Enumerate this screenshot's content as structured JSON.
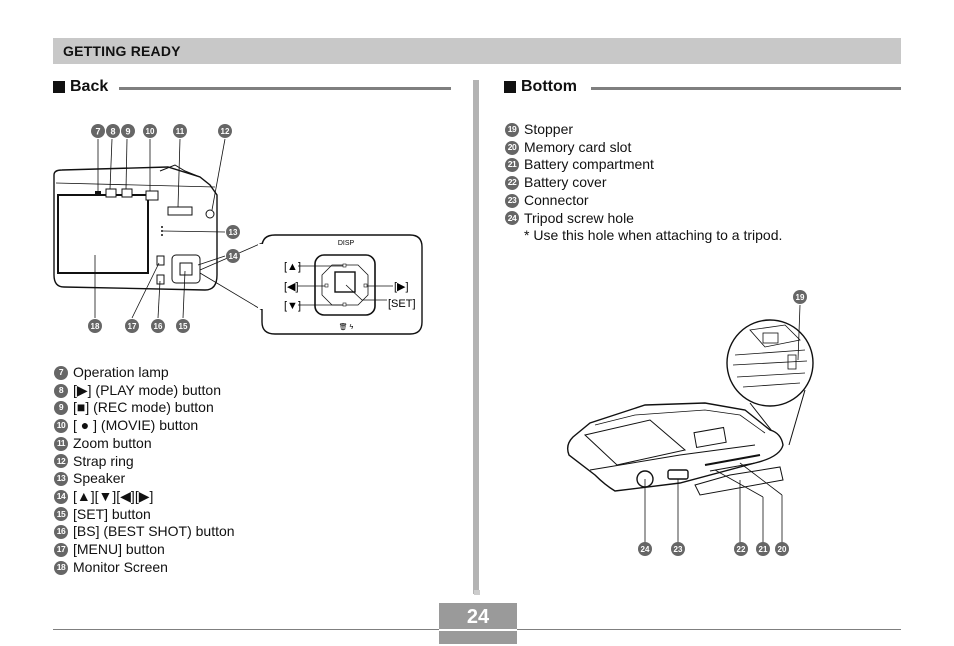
{
  "header": {
    "title": "GETTING READY"
  },
  "back": {
    "title": "Back",
    "callouts": [
      "7",
      "8",
      "9",
      "10",
      "11",
      "12",
      "13",
      "14",
      "15",
      "16",
      "17",
      "18"
    ],
    "dpad": {
      "top_label": "DISP",
      "up": "[▲]",
      "left": "[◀]",
      "down": "[▼]",
      "right": "[▶]",
      "set": "[SET]",
      "bottom_label": "🗑 ϟ"
    },
    "items": [
      {
        "num": "7",
        "text": "Operation lamp"
      },
      {
        "num": "8",
        "text": "[▶] (PLAY mode) button",
        "icon": "play-icon"
      },
      {
        "num": "9",
        "text": "[■] (REC mode) button",
        "icon": "camera-icon"
      },
      {
        "num": "10",
        "text": "[ ● ] (MOVIE) button",
        "icon": "movie-dot-icon"
      },
      {
        "num": "11",
        "text": "Zoom button"
      },
      {
        "num": "12",
        "text": "Strap ring"
      },
      {
        "num": "13",
        "text": "Speaker"
      },
      {
        "num": "14",
        "text": "[▲][▼][◀][▶]"
      },
      {
        "num": "15",
        "text": "[SET] button"
      },
      {
        "num": "16",
        "text": "[BS] (BEST SHOT) button"
      },
      {
        "num": "17",
        "text": "[MENU] button"
      },
      {
        "num": "18",
        "text": "Monitor Screen"
      }
    ]
  },
  "bottom": {
    "title": "Bottom",
    "callouts": [
      "19",
      "20",
      "21",
      "22",
      "23",
      "24"
    ],
    "items": [
      {
        "num": "19",
        "text": "Stopper"
      },
      {
        "num": "20",
        "text": "Memory card slot"
      },
      {
        "num": "21",
        "text": "Battery compartment"
      },
      {
        "num": "22",
        "text": "Battery cover"
      },
      {
        "num": "23",
        "text": "Connector"
      },
      {
        "num": "24",
        "text": "Tripod screw hole"
      }
    ],
    "note": "* Use this hole when attaching to a tripod."
  },
  "footer": {
    "page_number": "24"
  }
}
